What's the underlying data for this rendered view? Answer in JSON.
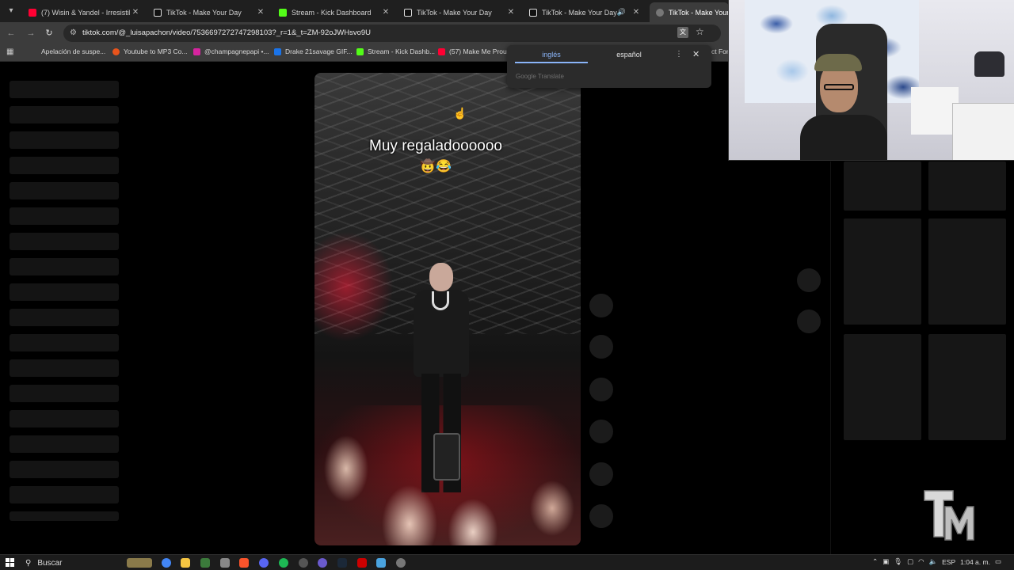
{
  "browser": {
    "tabs": [
      {
        "title": "(7) Wisin & Yandel - Irresistible",
        "icon": "youtube-icon",
        "color": "#ff0033"
      },
      {
        "title": "TikTok - Make Your Day",
        "icon": "tiktok-icon",
        "color": "#ffffff"
      },
      {
        "title": "Stream - Kick Dashboard",
        "icon": "kick-icon",
        "color": "#53fc18"
      },
      {
        "title": "TikTok - Make Your Day",
        "icon": "tiktok-icon",
        "color": "#ffffff"
      },
      {
        "title": "TikTok - Make Your Day",
        "icon": "tiktok-icon",
        "color": "#ffffff"
      },
      {
        "title": "TikTok - Make Your Da",
        "icon": "tiktok-icon",
        "color": "#ffffff"
      }
    ],
    "url": "tiktok.com/@_luisapachon/video/7536697272747298103?_r=1&_t=ZM-92oJWHsvo9U",
    "bookmarks": [
      {
        "label": "Apelación de suspe...",
        "color": "#3c3c3c"
      },
      {
        "label": "Youtube to MP3 Co...",
        "color": "#e8541c"
      },
      {
        "label": "@champagnepapi •...",
        "color": "#d6249f"
      },
      {
        "label": "Drake 21savage GIF...",
        "color": "#1a73e8"
      },
      {
        "label": "Stream - Kick Dashb...",
        "color": "#53fc18"
      },
      {
        "label": "(57) Make Me Prou...",
        "color": "#ff0033"
      }
    ],
    "bookmark_trailing": "ct For"
  },
  "translate_popup": {
    "tab_source": "inglés",
    "tab_target": "español",
    "footer": "Google Translate"
  },
  "video": {
    "caption": "Muy regaladoooooo",
    "emojis": "🤠😂"
  },
  "taskbar": {
    "search_label": "Buscar",
    "language": "ESP",
    "time": "1:04 a. m."
  },
  "colors": {
    "accent_blue": "#8ab4f8",
    "page_bg": "#000000",
    "chrome_bg": "#3c3c3c"
  }
}
